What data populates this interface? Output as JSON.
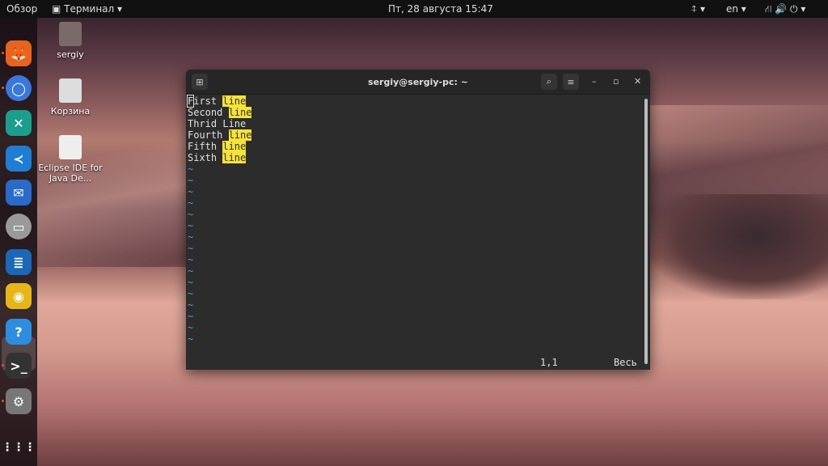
{
  "topbar": {
    "overview": "Обзор",
    "app_menu": "Терминал ▾",
    "clock": "Пт, 28 августа  15:47",
    "accessibility": "⍏ ▾",
    "lang": "en ▾",
    "system": "⛙ 🔊 ⏻ ▾"
  },
  "desktop": [
    {
      "label": "sergiy"
    },
    {
      "label": "Корзина"
    },
    {
      "label": "Eclipse IDE for Java De..."
    }
  ],
  "dock": [
    {
      "name": "firefox",
      "color": "#e8641e",
      "glyph": "🦊"
    },
    {
      "name": "chromium",
      "color": "#3b78d8",
      "glyph": "◯"
    },
    {
      "name": "gitkraken",
      "color": "#1b9e8e",
      "glyph": "✕"
    },
    {
      "name": "vscode",
      "color": "#1f7ed4",
      "glyph": "≺"
    },
    {
      "name": "thunderbird",
      "color": "#2a6ac9",
      "glyph": "✉"
    },
    {
      "name": "files",
      "color": "#9a9a9a",
      "glyph": "▭"
    },
    {
      "name": "writer",
      "color": "#1c68b7",
      "glyph": "≣"
    },
    {
      "name": "rhythmbox",
      "color": "#e6b619",
      "glyph": "◉"
    },
    {
      "name": "help",
      "color": "#2d8ee0",
      "glyph": "?"
    },
    {
      "name": "terminal",
      "color": "#333",
      "glyph": ">_"
    },
    {
      "name": "settings",
      "color": "#777",
      "glyph": "⚙"
    }
  ],
  "dock_apps_grid": "⋮⋮⋮",
  "terminal": {
    "title": "sergiy@sergiy-pc: ~",
    "lines": [
      {
        "pre": "First ",
        "hl": "line"
      },
      {
        "pre": "Second ",
        "hl": "line"
      },
      {
        "pre": "Thrid Line",
        "hl": ""
      },
      {
        "pre": "Fourth ",
        "hl": "line"
      },
      {
        "pre": "Fifth ",
        "hl": "line"
      },
      {
        "pre": "Sixth ",
        "hl": "line"
      }
    ],
    "tilde": "~",
    "tilde_count": 16,
    "position": "1,1",
    "scroll": "Весь"
  }
}
